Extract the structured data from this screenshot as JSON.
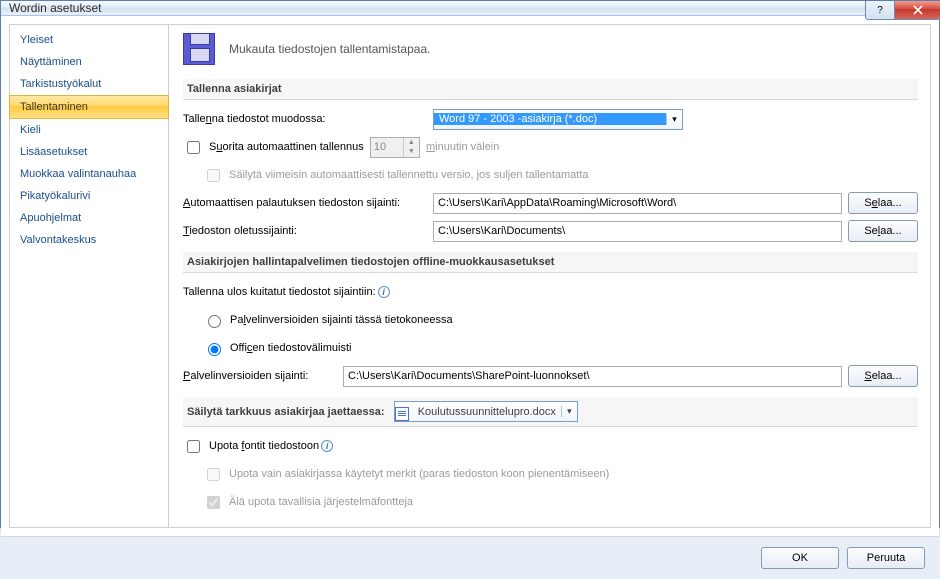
{
  "window": {
    "title": "Wordin asetukset"
  },
  "sidebar": {
    "items": [
      {
        "label": "Yleiset"
      },
      {
        "label": "Näyttäminen"
      },
      {
        "label": "Tarkistustyökalut"
      },
      {
        "label": "Tallentaminen",
        "selected": true
      },
      {
        "label": "Kieli"
      },
      {
        "label": "Lisäasetukset"
      },
      {
        "label": "Muokkaa valintanauhaa"
      },
      {
        "label": "Pikatyökalurivi"
      },
      {
        "label": "Apuohjelmat"
      },
      {
        "label": "Valvontakeskus"
      }
    ]
  },
  "header": {
    "text": "Mukauta tiedostojen tallentamistapaa."
  },
  "sections": {
    "save_docs_title": "Tallenna asiakirjat",
    "format_label": "Tallenna tiedostot muodossa:",
    "format_value": "Word 97 - 2003 -asiakirja (*.doc)",
    "autosave_label": "Suorita automaattinen tallennus",
    "autosave_value": "10",
    "autosave_suffix": "minuutin välein",
    "keep_last_label": "Säilytä viimeisin automaattisesti tallennettu versio, jos suljen tallentamatta",
    "autorecover_label": "Automaattisen palautuksen tiedoston sijainti:",
    "autorecover_path": "C:\\Users\\Kari\\AppData\\Roaming\\Microsoft\\Word\\",
    "default_loc_label": "Tiedoston oletussijainti:",
    "default_loc_path": "C:\\Users\\Kari\\Documents\\",
    "offline_title": "Asiakirjojen hallintapalvelimen tiedostojen offline-muokkausasetukset",
    "checkout_lead": "Tallenna ulos kuitatut tiedostot sijaintiin:",
    "radio1": "Palvelinversioiden sijainti tässä tietokoneessa",
    "radio2": "Officen tiedostovälimuisti",
    "server_drafts_label": "Palvelinversioiden sijainti:",
    "server_drafts_path": "C:\\Users\\Kari\\Documents\\SharePoint-luonnokset\\",
    "fidelity_title": "Säilytä tarkkuus asiakirjaa jaettaessa:",
    "fidelity_doc": "Koulutussuunnittelupro.docx",
    "embed_fonts": "Upota fontit tiedostoon",
    "embed_subset": "Upota vain asiakirjassa käytetyt merkit (paras tiedoston koon pienentämiseen)",
    "embed_nosys": "Älä upota tavallisia järjestelmäfontteja"
  },
  "buttons": {
    "browse": "Selaa...",
    "ok": "OK",
    "cancel": "Peruuta"
  }
}
